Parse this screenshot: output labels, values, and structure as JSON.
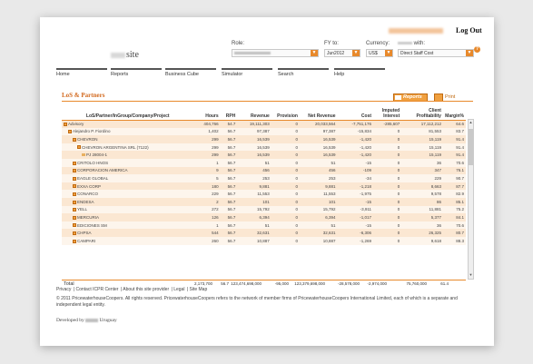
{
  "header": {
    "site_name": "site",
    "logout": "Log Out",
    "role_label": "Role:",
    "fy_label": "FY to:",
    "fy_value": "Jun2012",
    "currency_label": "Currency:",
    "currency_value": "US$",
    "with_label": "with:",
    "with_value": "Direct Staff Cost"
  },
  "nav": [
    "Home",
    "Reports",
    "Business Cube",
    "Simulator",
    "Search",
    "Help"
  ],
  "section": {
    "title": "LoS & Partners",
    "reports_btn": "Reports",
    "print_btn": "Print"
  },
  "table": {
    "columns": [
      "LoS/Partner/InGroup/Company/Project",
      "Hours",
      "RPH",
      "Revenue",
      "Provision",
      "Net Revenue",
      "Cost",
      "Imputed Interest",
      "Client Profitability",
      "Margin%"
    ],
    "rows": [
      {
        "name": "Advisory",
        "lvl": 0,
        "v": [
          "404,766",
          "54.7",
          "19,111,303",
          "0",
          "20,033,564",
          "-7,751,176",
          "-285,607",
          "17,112,212",
          "64.6"
        ]
      },
      {
        "name": "Alejandro P. Fiordino",
        "lvl": 1,
        "v": [
          "1,402",
          "56.7",
          "97,387",
          "0",
          "97,387",
          "-15,834",
          "0",
          "81,553",
          "83.7"
        ]
      },
      {
        "name": "CHEVRON",
        "lvl": 2,
        "v": [
          "299",
          "56.7",
          "16,539",
          "0",
          "16,539",
          "-1,420",
          "0",
          "15,119",
          "91.4"
        ]
      },
      {
        "name": "CHEVRON ARGENTINA SRL (7122)",
        "lvl": 3,
        "v": [
          "299",
          "56.7",
          "16,539",
          "0",
          "16,539",
          "-1,420",
          "0",
          "15,119",
          "91.4"
        ]
      },
      {
        "name": "PJ 28004-1",
        "lvl": 4,
        "v": [
          "299",
          "56.7",
          "16,539",
          "0",
          "16,539",
          "-1,420",
          "0",
          "15,119",
          "91.4"
        ]
      },
      {
        "name": "CRITOLO HNOS",
        "lvl": 2,
        "v": [
          "1",
          "56.7",
          "51",
          "0",
          "51",
          "-15",
          "0",
          "36",
          "70.6"
        ]
      },
      {
        "name": "CORPORACION AMERICA",
        "lvl": 2,
        "v": [
          "9",
          "56.7",
          "456",
          "0",
          "456",
          "-109",
          "0",
          "347",
          "76.1"
        ]
      },
      {
        "name": "EAGLE GLOBAL",
        "lvl": 2,
        "v": [
          "5",
          "56.7",
          "253",
          "0",
          "253",
          "-34",
          "0",
          "229",
          "90.7"
        ]
      },
      {
        "name": "EXXA CORP",
        "lvl": 2,
        "v": [
          "180",
          "56.7",
          "9,881",
          "0",
          "9,881",
          "-1,218",
          "0",
          "8,663",
          "87.7"
        ]
      },
      {
        "name": "CONARCO",
        "lvl": 2,
        "v": [
          "229",
          "56.7",
          "11,553",
          "0",
          "11,553",
          "-1,975",
          "0",
          "9,578",
          "82.9"
        ]
      },
      {
        "name": "ENDESA",
        "lvl": 2,
        "v": [
          "2",
          "56.7",
          "101",
          "0",
          "101",
          "-15",
          "0",
          "86",
          "85.1"
        ]
      },
      {
        "name": "YELL",
        "lvl": 2,
        "v": [
          "272",
          "56.7",
          "15,792",
          "0",
          "15,792",
          "-3,911",
          "0",
          "11,881",
          "75.2"
        ]
      },
      {
        "name": "MERCURIA",
        "lvl": 2,
        "v": [
          "126",
          "56.7",
          "6,394",
          "0",
          "6,394",
          "-1,017",
          "0",
          "5,377",
          "84.1"
        ]
      },
      {
        "name": "EDICIONES SM",
        "lvl": 2,
        "v": [
          "1",
          "56.7",
          "51",
          "0",
          "51",
          "-15",
          "0",
          "36",
          "70.6"
        ]
      },
      {
        "name": "CHPSA",
        "lvl": 2,
        "v": [
          "544",
          "56.7",
          "32,631",
          "0",
          "32,631",
          "-6,306",
          "0",
          "26,325",
          "80.7"
        ]
      },
      {
        "name": "CAMPARI",
        "lvl": 2,
        "v": [
          "260",
          "56.7",
          "10,887",
          "0",
          "10,887",
          "-1,269",
          "0",
          "9,618",
          "88.3"
        ]
      }
    ],
    "total_label": "Total",
    "total": [
      "2,173,700",
      "56.7",
      "123,474,698,000",
      "-95,000",
      "123,379,698,000",
      "-28,578,000",
      "-2,974,000",
      "75,760,000",
      "61.4"
    ]
  },
  "footer": {
    "links": [
      "Privacy",
      "Contact ICPR Center",
      "About this site provider",
      "Legal",
      "Site Map"
    ],
    "copyright": "© 2011 PricewaterhouseCoopers. All rights reserved. PricewaterhouseCoopers refers to the network of member firms of PricewaterhouseCoopers International Limited, each of which is a separate and independent legal entity.",
    "developed_by": "Developed by",
    "developed_suffix": "Uruguay"
  },
  "colors": {
    "accent": "#e8892b",
    "row_odd": "#fbe7d2",
    "row_even": "#fdf5ec",
    "title": "#d2691e"
  }
}
